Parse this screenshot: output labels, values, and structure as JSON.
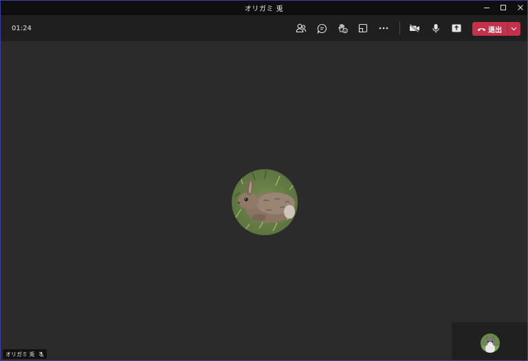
{
  "window": {
    "title": "オリガミ 兎",
    "controls": {
      "minimize_icon": "minimize-icon",
      "maximize_icon": "maximize-icon",
      "close_icon": "close-icon"
    }
  },
  "call": {
    "timer": "01:24",
    "toolbar": {
      "icons": [
        "participants-icon",
        "chat-icon",
        "reactions-icon",
        "share-screen-icon",
        "more-options-icon",
        "camera-off-icon",
        "microphone-icon",
        "share-tray-icon"
      ],
      "leave_label": "退出",
      "leave_color": "#c4314b"
    }
  },
  "stage": {
    "main_avatar": "rabbit-photo",
    "participant_name": "オリガミ 兎",
    "participant_muted": true,
    "self_avatar": "cat-photo"
  },
  "colors": {
    "background": "#2b2b2b",
    "titlebar": "#0f0f0f",
    "callbar": "#1f1f1f",
    "accent_border": "#3b3fa8"
  }
}
